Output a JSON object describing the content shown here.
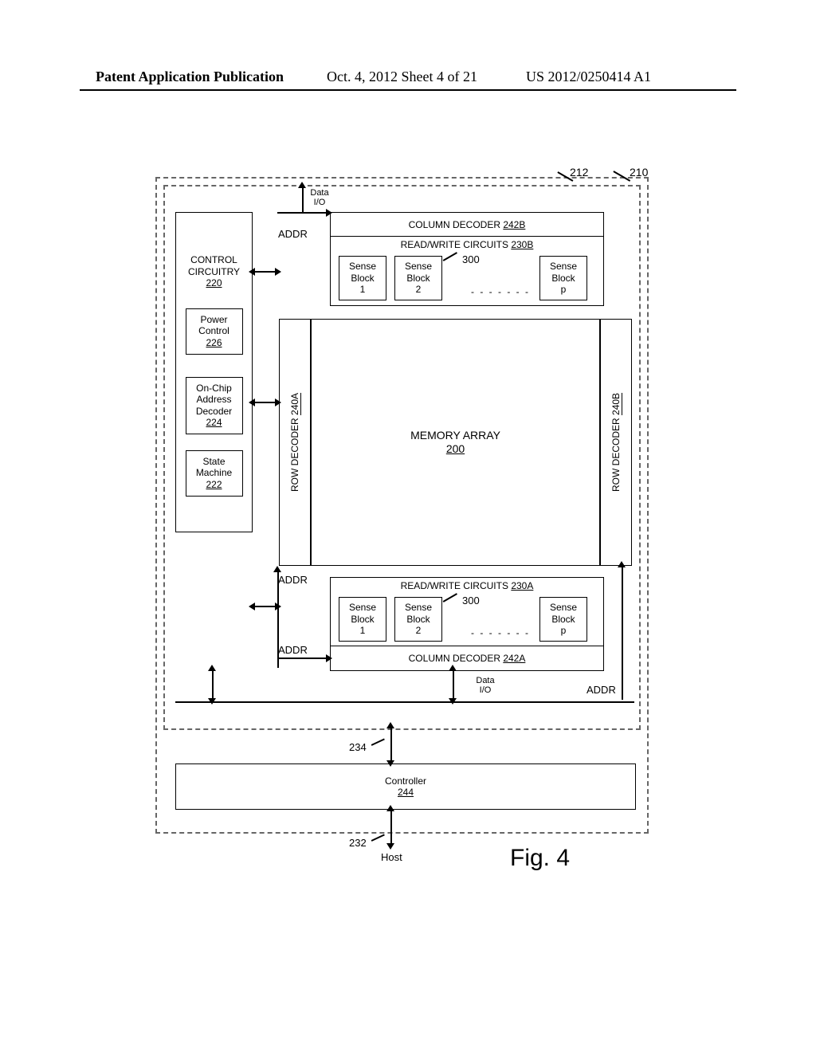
{
  "header": {
    "left": "Patent Application Publication",
    "mid": "Oct. 4, 2012  Sheet 4 of 21",
    "right": "US 2012/0250414 A1"
  },
  "refs": {
    "system": "210",
    "chip": "212",
    "memarr": "200",
    "ctrl": "220",
    "state": "222",
    "addrdec": "224",
    "power": "226",
    "rowA": "240A",
    "rowB": "240B",
    "rwA": "230A",
    "rwB": "230B",
    "colA": "242A",
    "colB": "242B",
    "sense": "300",
    "bus": "234",
    "hostbus": "232",
    "ctrlr": "244"
  },
  "labels": {
    "dataio": "Data\nI/O",
    "addr": "ADDR",
    "controlCircuitry": "CONTROL\nCIRCUITRY",
    "power": "Power\nControl",
    "addrdec": "On-Chip\nAddress\nDecoder",
    "state": "State\nMachine",
    "rowdec": "ROW DECODER",
    "coldec": "COLUMN DECODER",
    "rw": "READ/WRITE CIRCUITS",
    "memarr": "MEMORY ARRAY",
    "sense": "Sense\nBlock",
    "sense1": "1",
    "sense2": "2",
    "sensep": "p",
    "controller": "Controller",
    "host": "Host",
    "figure": "Fig. 4"
  }
}
